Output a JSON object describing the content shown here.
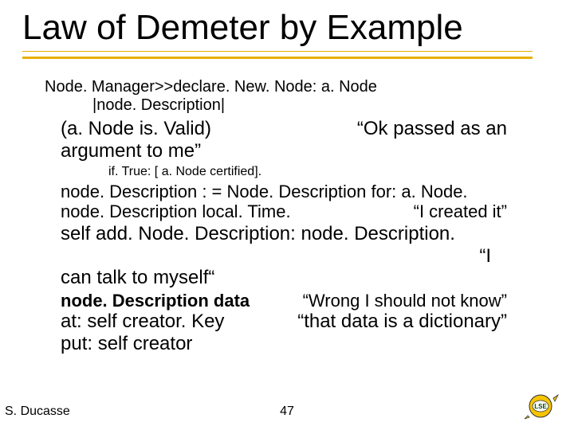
{
  "title": "Law of Demeter by Example",
  "code": {
    "method_header": "Node. Manager>>declare. New. Node: a. Node",
    "temp_vars": "|node. Description|",
    "guard_expr": "(a. Node is. Valid)",
    "guard_comment": "“Ok passed as an",
    "guard_cont": "argument to me”",
    "iftrue": "if. True: [ a. Node certified].",
    "assign1": "node. Description : = Node. Description for: a. Node.",
    "assign2_left": "node. Description local. Time.",
    "assign2_right": "“I created it”",
    "self_add": "self add. Node. Description: node. Description.",
    "quote_i": "“I",
    "can_talk": "can talk to myself“",
    "data_left": "node. Description data",
    "data_right": "“Wrong I should not know”",
    "at_left": "at: self creator. Key",
    "at_right": "“that data is a dictionary”",
    "put": "put: self creator"
  },
  "footer": {
    "author": "S. Ducasse",
    "page": "47"
  },
  "logo": {
    "text": "LSE",
    "fill": "#f6c400",
    "text_fill": "#004b00"
  }
}
